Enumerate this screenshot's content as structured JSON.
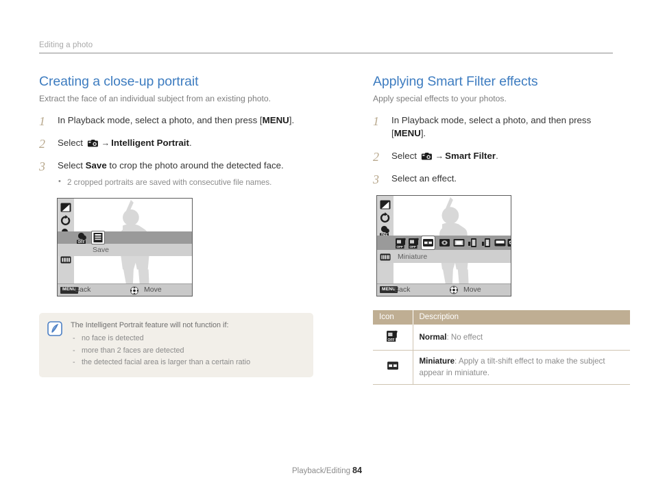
{
  "header": {
    "running_title": "Editing a photo"
  },
  "left_column": {
    "title": "Creating a close-up portrait",
    "subtitle": "Extract the face of an individual subject from an existing photo.",
    "steps": [
      {
        "num": "1",
        "text_before": "In Playback mode, select a photo, and then press [",
        "bold": "MENU",
        "text_after": "]."
      },
      {
        "num": "2",
        "text_before": "Select ",
        "icon": "camera-menu-icon",
        "arrow": "→",
        "bold": "Intelligent Portrait",
        "text_after": "."
      },
      {
        "num": "3",
        "text_before": "Select ",
        "bold": "Save",
        "text_after": " to crop the photo around the detected face.",
        "bullets": [
          "2 cropped portraits are saved with consecutive file names."
        ]
      }
    ],
    "lcd": {
      "menu_label": "Save",
      "bottom_bar": {
        "menu_chip": "MENU",
        "back_label": "Back",
        "move_label": "Move"
      },
      "sidebar_icons": [
        "resize-icon",
        "rotate-icon",
        "smart-filter-off-icon",
        "face-retouch-off-icon",
        "brightness-icon"
      ],
      "row_icons": [
        "face-retouch-off-icon",
        "save-icon"
      ]
    },
    "note": {
      "icon": "note-pen-icon",
      "title": "The Intelligent Portrait feature will not function if:",
      "items": [
        "no face is detected",
        "more than 2 faces are detected",
        "the detected facial area is larger than a certain ratio"
      ]
    }
  },
  "right_column": {
    "title": "Applying Smart Filter effects",
    "subtitle": "Apply special effects to your photos.",
    "steps": [
      {
        "num": "1",
        "text_before": "In Playback mode, select a photo, and then press [",
        "bold": "MENU",
        "text_after": "]."
      },
      {
        "num": "2",
        "text_before": "Select ",
        "icon": "camera-menu-icon",
        "arrow": "→",
        "bold": "Smart Filter",
        "text_after": "."
      },
      {
        "num": "3",
        "text_before": "Select an effect.",
        "bold": "",
        "text_after": ""
      }
    ],
    "lcd": {
      "menu_label": "Miniature",
      "bottom_bar": {
        "menu_chip": "MENU",
        "back_label": "Back",
        "move_label": "Move"
      },
      "sidebar_icons": [
        "resize-icon",
        "rotate-icon",
        "face-retouch-off-icon",
        "smart-filter-off-icon",
        "brightness-icon"
      ],
      "filter_strip_icons": [
        "smart-filter-off-icon",
        "normal-off-icon",
        "miniature-icon",
        "vignetting-icon",
        "soft-focus-icon",
        "old-film1-icon",
        "old-film2-icon",
        "half-tone-dot-icon",
        "sketch-icon"
      ],
      "strip_more": "›"
    },
    "table": {
      "headers": [
        "Icon",
        "Description"
      ],
      "rows": [
        {
          "icon": "normal-off-icon",
          "label": "Normal",
          "desc": ": No effect"
        },
        {
          "icon": "miniature-icon",
          "label": "Miniature",
          "desc": ": Apply a tilt-shift effect to make the subject appear in miniature."
        }
      ]
    }
  },
  "footer": {
    "section": "Playback/Editing",
    "page": "84"
  },
  "colors": {
    "heading_blue": "#3d7cc0",
    "step_number_tan": "#b9a98e",
    "table_header_tan": "#bfae93",
    "note_bg": "#f2efe9",
    "body_text": "#353535",
    "muted_text": "#8b8b8b"
  }
}
